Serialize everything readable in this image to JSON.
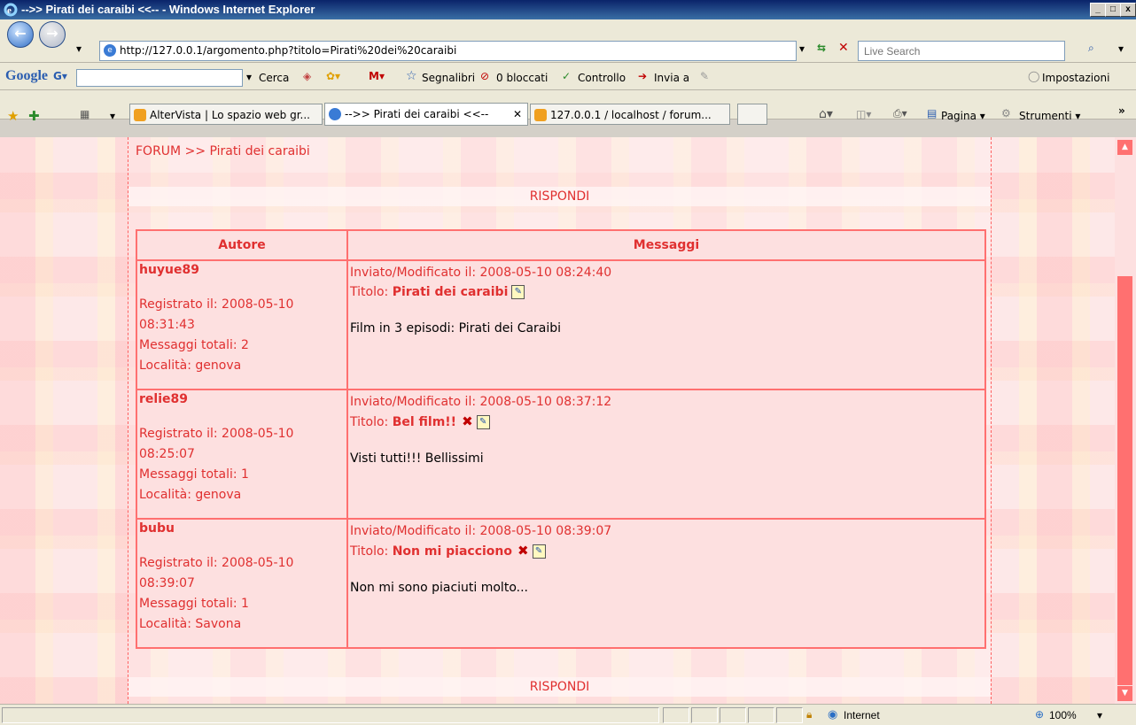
{
  "window": {
    "title": "-->> Pirati dei caraibi <<-- - Windows Internet Explorer",
    "minimize": "_",
    "maximize": "□",
    "close": "x"
  },
  "address_bar": {
    "url": "http://127.0.0.1/argomento.php?titolo=Pirati%20dei%20caraibi",
    "search_placeholder": "Live Search"
  },
  "google_toolbar": {
    "logo": "Google",
    "cerca": "Cerca",
    "segnalibri": "Segnalibri",
    "bloccati": "0 bloccati",
    "controllo": "Controllo",
    "invia": "Invia a",
    "impostazioni": "Impostazioni"
  },
  "tabs": [
    {
      "label": "AlterVista | Lo spazio web gr..."
    },
    {
      "label": "-->> Pirati dei caraibi <<--",
      "close": "✕"
    },
    {
      "label": "127.0.0.1 / localhost / forum..."
    }
  ],
  "command_bar": {
    "pagina": "Pagina",
    "strumenti": "Strumenti"
  },
  "breadcrumb": {
    "forum": "FORUM",
    "separator": " >> ",
    "topic": "Pirati dei caraibi"
  },
  "reply_label": "RISPONDI",
  "table": {
    "header_author": "Autore",
    "header_messages": "Messaggi",
    "posts": [
      {
        "author": "huyue89",
        "registered": "Registrato il: 2008-05-10",
        "registered_time": "08:31:43",
        "total": "Messaggi totali: 2",
        "location": "Località: genova",
        "sent": "Inviato/Modificato il: 2008-05-10 08:24:40",
        "title_label": "Titolo: ",
        "title": "Pirati dei caraibi",
        "body": "Film in 3 episodi: Pirati dei Caraibi",
        "deletable": false
      },
      {
        "author": "relie89",
        "registered": "Registrato il: 2008-05-10",
        "registered_time": "08:25:07",
        "total": "Messaggi totali: 1",
        "location": "Località: genova",
        "sent": "Inviato/Modificato il: 2008-05-10 08:37:12",
        "title_label": "Titolo: ",
        "title": "Bel film!!",
        "body": "Visti tutti!!! Bellissimi",
        "deletable": true
      },
      {
        "author": "bubu",
        "registered": "Registrato il: 2008-05-10",
        "registered_time": "08:39:07",
        "total": "Messaggi totali: 1",
        "location": "Località: Savona",
        "sent": "Inviato/Modificato il: 2008-05-10 08:39:07",
        "title_label": "Titolo: ",
        "title": "Non mi piacciono",
        "body": "Non mi sono piaciuti molto...",
        "deletable": true
      }
    ]
  },
  "statusbar": {
    "zone": "Internet",
    "zoom": "100%"
  },
  "colors": {
    "accent": "#e03030",
    "border": "#ff7070",
    "titlebar": "#0a246a"
  }
}
